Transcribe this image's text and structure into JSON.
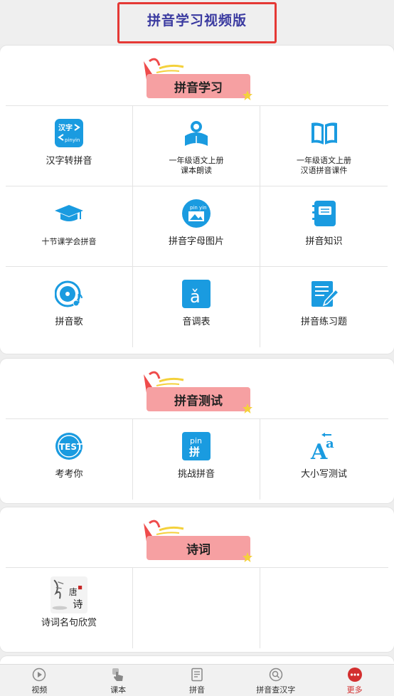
{
  "header": {
    "title": "拼音学习视频版"
  },
  "sections": [
    {
      "title": "拼音学习",
      "items": [
        {
          "label": "汉字转拼音",
          "icon": "hanzi-pinyin-convert-icon"
        },
        {
          "label": "一年级语文上册\n课本朗读",
          "icon": "reading-person-icon"
        },
        {
          "label": "一年级语文上册\n汉语拼音课件",
          "icon": "open-book-icon"
        },
        {
          "label": "十节课学会拼音",
          "icon": "graduation-cap-icon"
        },
        {
          "label": "拼音字母图片",
          "icon": "pinyin-picture-icon"
        },
        {
          "label": "拼音知识",
          "icon": "notebook-icon"
        },
        {
          "label": "拼音歌",
          "icon": "music-disc-icon"
        },
        {
          "label": "音调表",
          "icon": "tone-a-icon"
        },
        {
          "label": "拼音练习题",
          "icon": "exercise-pen-icon"
        }
      ]
    },
    {
      "title": "拼音测试",
      "items": [
        {
          "label": "考考你",
          "icon": "test-badge-icon"
        },
        {
          "label": "挑战拼音",
          "icon": "pin-challenge-icon"
        },
        {
          "label": "大小写测试",
          "icon": "case-letters-icon"
        }
      ]
    },
    {
      "title": "诗词",
      "items": [
        {
          "label": "诗词名句欣赏",
          "icon": "poetry-painting-icon"
        }
      ]
    }
  ],
  "nav": [
    {
      "label": "视频",
      "icon": "play-circle-icon"
    },
    {
      "label": "课本",
      "icon": "hand-tap-icon"
    },
    {
      "label": "拼音",
      "icon": "document-icon"
    },
    {
      "label": "拼音查汉字",
      "icon": "search-icon"
    },
    {
      "label": "更多",
      "icon": "more-dots-icon",
      "active": true
    }
  ],
  "colors": {
    "accent": "#1a9be0",
    "banner": "#f6a0a2",
    "annotation": "#e53935",
    "active": "#d32f2f",
    "title": "#3a3aa0"
  }
}
